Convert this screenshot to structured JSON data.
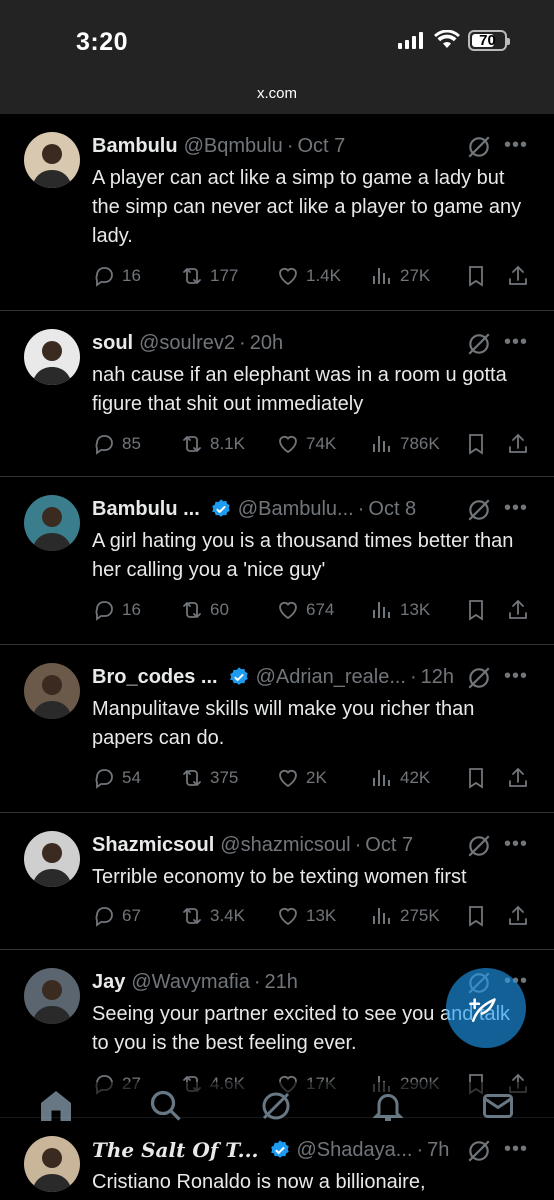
{
  "status": {
    "time": "3:20",
    "battery": "70",
    "battery_fraction": 0.7
  },
  "browser": {
    "url": "x.com"
  },
  "tweets": [
    {
      "name": "Bambulu",
      "handle": "@Bqmbulu",
      "time": "Oct 7",
      "text": "A player can act like a simp to game a lady but the simp can never act like a player to game any lady.",
      "replies": "16",
      "reposts": "177",
      "likes": "1.4K",
      "views": "27K",
      "verified": false,
      "avatar_color": "#d9c8b0"
    },
    {
      "name": "soul",
      "handle": "@soulrev2",
      "time": "20h",
      "text": "nah cause if an elephant was in a room u gotta figure that shit out immediately",
      "replies": "85",
      "reposts": "8.1K",
      "likes": "74K",
      "views": "786K",
      "verified": false,
      "avatar_color": "#e9e9e9"
    },
    {
      "name": "Bambulu ...",
      "handle": "@Bambulu...",
      "time": "Oct 8",
      "text": "A girl hating you is a thousand times better than her calling you a 'nice guy'",
      "replies": "16",
      "reposts": "60",
      "likes": "674",
      "views": "13K",
      "verified": true,
      "avatar_color": "#3a7d8c"
    },
    {
      "name": "Bro_codes ...",
      "handle": "@Adrian_reale...",
      "time": "12h",
      "text": "Manpulitave skills will make you richer than papers can do.",
      "replies": "54",
      "reposts": "375",
      "likes": "2K",
      "views": "42K",
      "verified": true,
      "avatar_color": "#6b5a4a"
    },
    {
      "name": "Shazmicsoul",
      "handle": "@shazmicsoul",
      "time": "Oct 7",
      "text": "Terrible economy to be texting women first",
      "replies": "67",
      "reposts": "3.4K",
      "likes": "13K",
      "views": "275K",
      "verified": false,
      "avatar_color": "#cfcfcf"
    },
    {
      "name": "Jay",
      "handle": "@Wavymafia",
      "time": "21h",
      "text": "Seeing your partner excited to see you and talk to you is the best feeling ever.",
      "replies": "27",
      "reposts": "4.6K",
      "likes": "17K",
      "views": "290K",
      "verified": false,
      "avatar_color": "#5a6570"
    },
    {
      "name": "The Salt Of T...",
      "handle": "@Shadaya...",
      "time": "7h",
      "text": "Cristiano Ronaldo is now a billionaire,",
      "replies": "",
      "reposts": "",
      "likes": "",
      "views": "",
      "verified": true,
      "avatar_color": "#c9b59a"
    }
  ],
  "colors": {
    "background": "#000000",
    "muted": "#71767b",
    "accent": "#1d9bf0",
    "divider": "#2f3336"
  },
  "icons": [
    "reply-icon",
    "repost-icon",
    "like-icon",
    "views-icon",
    "bookmark-icon",
    "share-icon",
    "grok-icon",
    "more-icon",
    "verified-icon",
    "compose-icon",
    "home-icon",
    "search-icon",
    "notifications-icon",
    "messages-icon"
  ]
}
